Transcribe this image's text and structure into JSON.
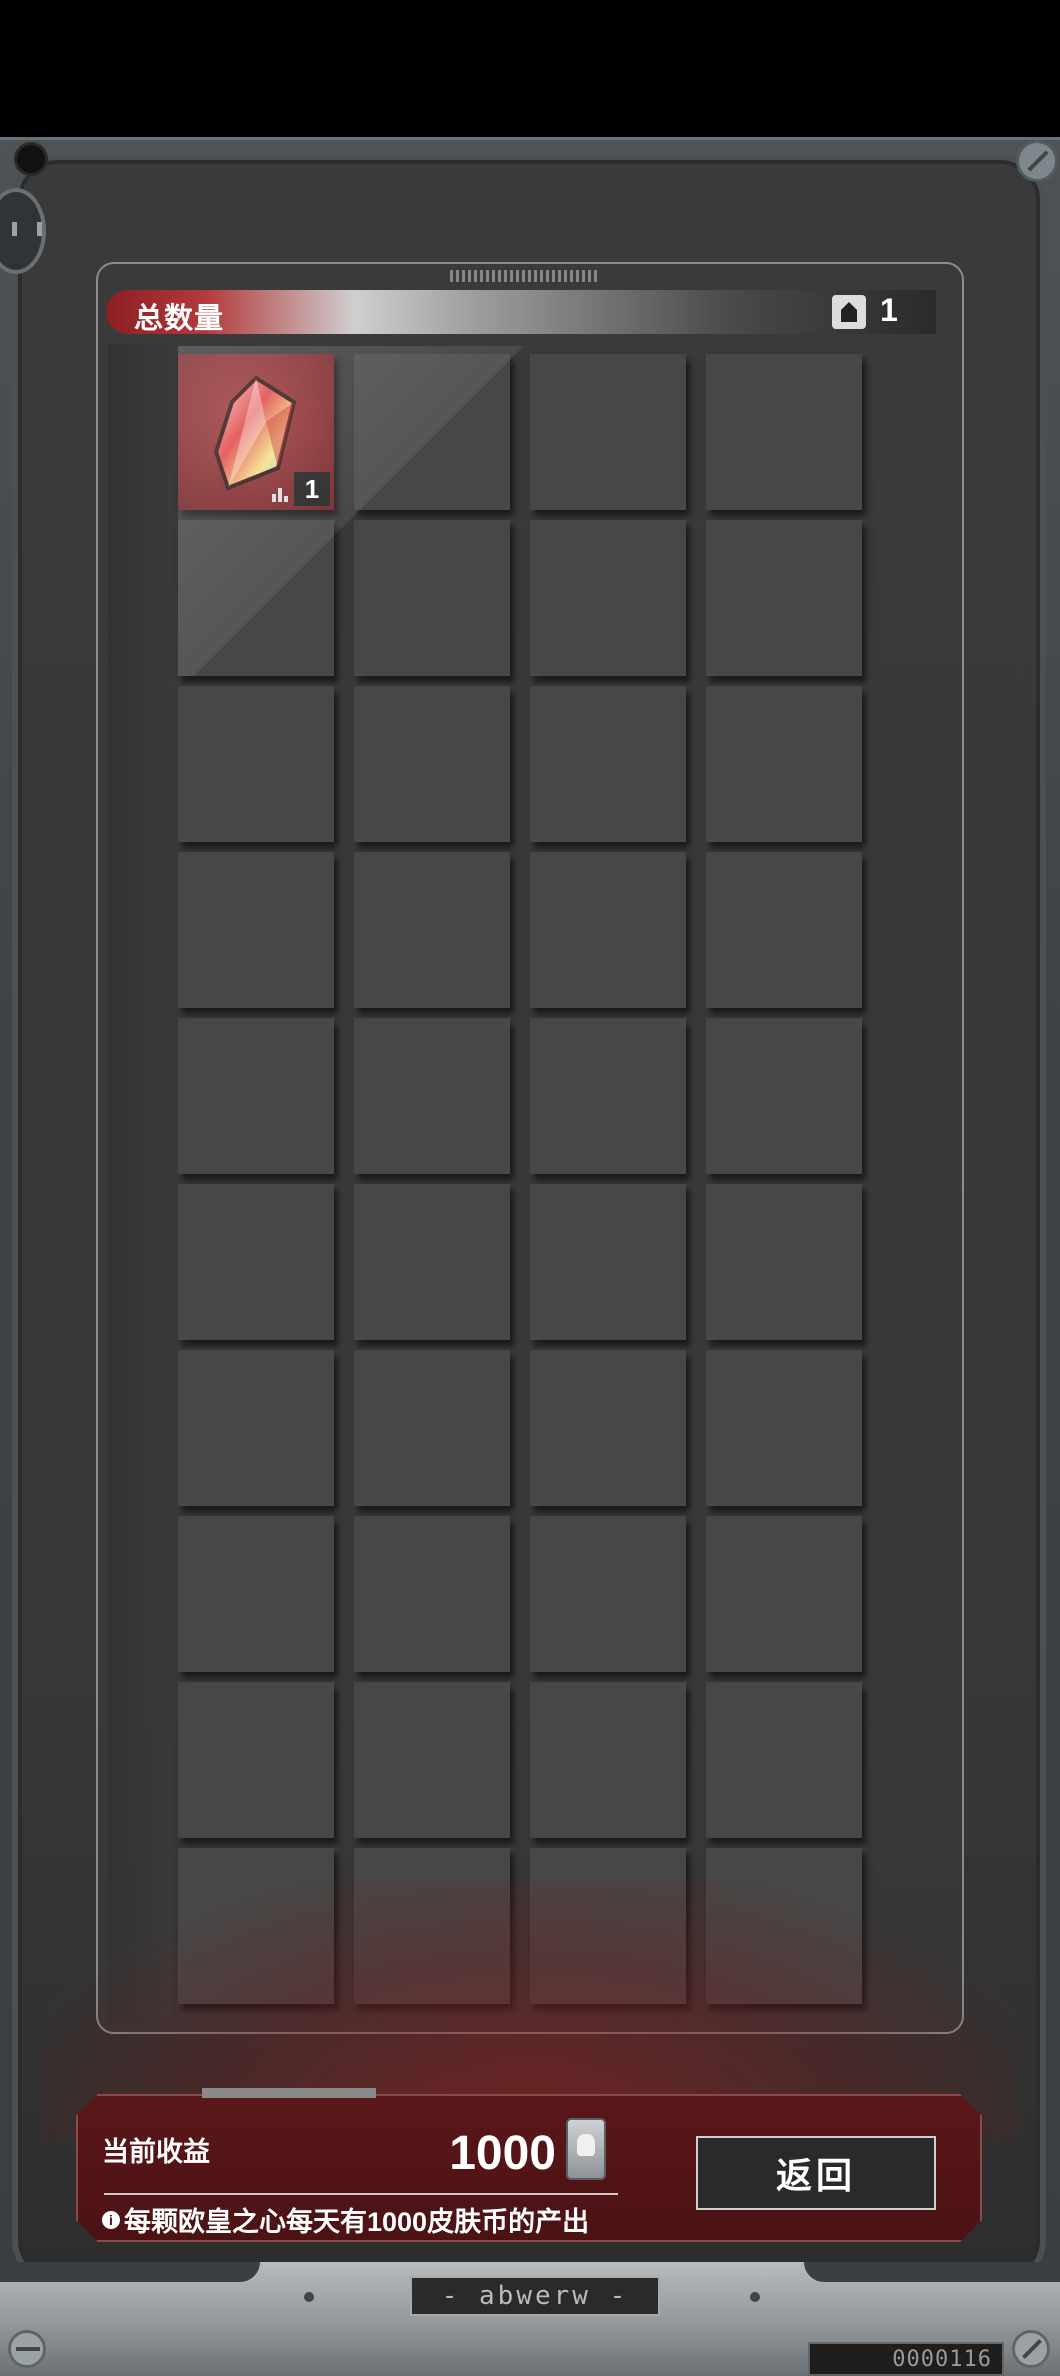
{
  "header": {
    "total_label": "总数量",
    "total_count": "1"
  },
  "inventory": {
    "rows": 10,
    "cols": 4,
    "items": [
      {
        "slot": 0,
        "name": "red-crystal-gem",
        "count": "1"
      }
    ]
  },
  "income": {
    "label": "当前收益",
    "value": "1000",
    "currency_icon": "skin-coin-icon",
    "note": "每颗欧皇之心每天有1000皮肤币的产出",
    "info_icon_glyph": "i"
  },
  "actions": {
    "return_label": "返回"
  },
  "device": {
    "model_label": "- abwerw -",
    "serial": "0000116"
  },
  "colors": {
    "accent_red": "#8c1e22",
    "cell_bg": "#474747",
    "income_bg": "#5a1719"
  }
}
